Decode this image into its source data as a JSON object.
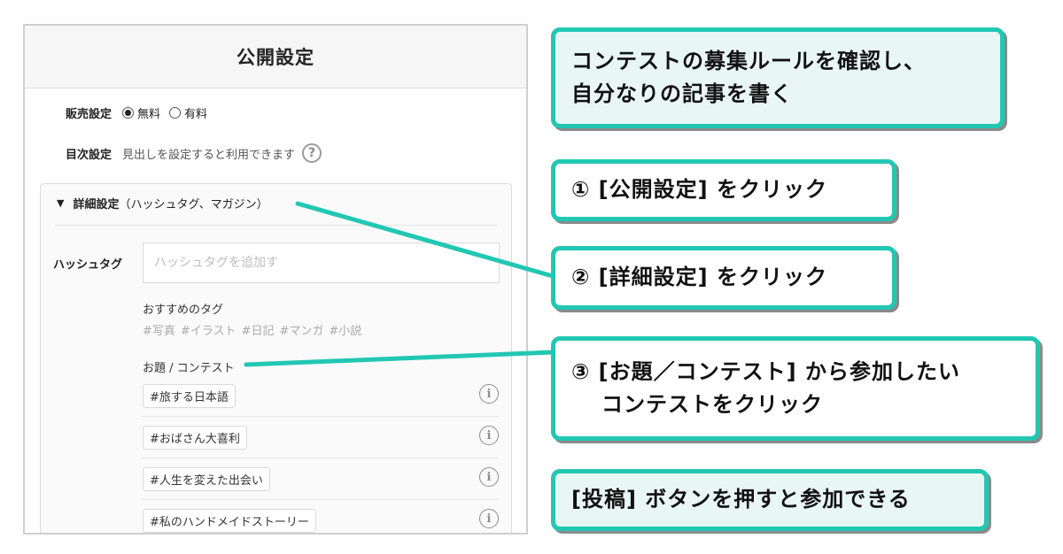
{
  "panel": {
    "title": "公開設定",
    "sales": {
      "label": "販売設定",
      "options": [
        "無料",
        "有料"
      ],
      "selected": "無料"
    },
    "toc": {
      "label": "目次設定",
      "text": "見出しを設定すると利用できます",
      "help": "?"
    },
    "details": {
      "label": "詳細設定",
      "sub": "（ハッシュタグ、マガジン）",
      "hashtag_label": "ハッシュタグ",
      "hashtag_placeholder": "ハッシュタグを追加す",
      "recommended_title": "おすすめのタグ",
      "recommended_tags": [
        "#写真",
        "#イラスト",
        "#日記",
        "#マンガ",
        "#小説"
      ],
      "contest_title": "お題 / コンテスト",
      "contests": [
        "#旅する日本語",
        "#おばさん大喜利",
        "#人生を変えた出会い",
        "#私のハンドメイドストーリー"
      ],
      "info": "i"
    }
  },
  "callouts": {
    "main": [
      "コンテストの募集ルールを確認し、",
      "自分なりの記事を書く"
    ],
    "step1": "① [公開設定] をクリック",
    "step2": "② [詳細設定] をクリック",
    "step3": [
      "③ [お題／コンテスト] から参加したい",
      "コンテストをクリック"
    ],
    "step4": "[投稿] ボタンを押すと参加できる"
  },
  "colors": {
    "accent": "#22c7b3",
    "accent_bg": "#e8f7f3"
  }
}
